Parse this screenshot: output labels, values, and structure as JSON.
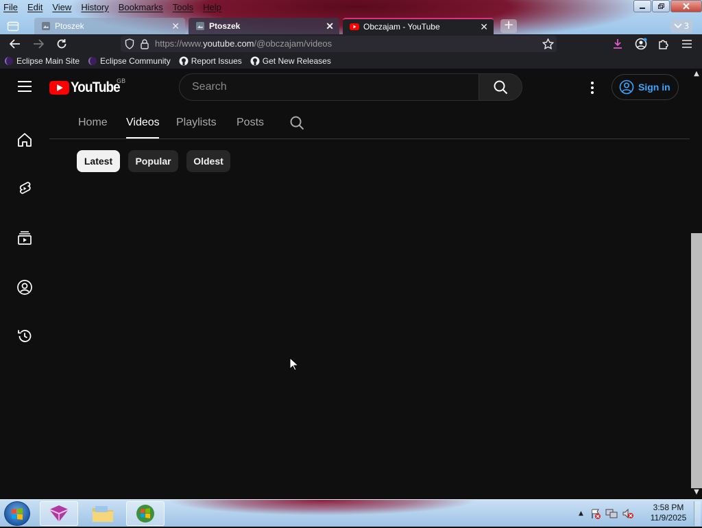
{
  "menubar": {
    "items": [
      "File",
      "Edit",
      "View",
      "History",
      "Bookmarks",
      "Tools",
      "Help"
    ]
  },
  "tabs": [
    {
      "title": "Ptoszek",
      "active": false
    },
    {
      "title": "Ptoszek",
      "active": false
    },
    {
      "title": "Obczajam - YouTube",
      "active": true
    }
  ],
  "tab_overflow_count": "3",
  "navbar": {
    "url_prefix": "https://www.",
    "url_domain": "youtube.com",
    "url_path": "/@obczajam/videos"
  },
  "bookmarks": [
    "Eclipse Main Site",
    "Eclipse Community",
    "Report Issues",
    "Get New Releases"
  ],
  "youtube": {
    "logo_text": "YouTube",
    "country_code": "GB",
    "search_placeholder": "Search",
    "signin_label": "Sign in",
    "channel_tabs": [
      "Home",
      "Videos",
      "Playlists",
      "Posts"
    ],
    "active_tab": "Videos",
    "sort_chips": [
      "Latest",
      "Popular",
      "Oldest"
    ],
    "active_chip": "Latest",
    "guide_icons": [
      "home-icon",
      "shorts-icon",
      "subscriptions-icon",
      "you-icon",
      "history-icon"
    ]
  },
  "colors": {
    "accent_red": "#ff0000",
    "link_blue": "#3ea6ff",
    "tab_active_border": "#e0307a"
  },
  "taskbar": {
    "time": "3:58 PM",
    "date": "11/9/2025"
  }
}
